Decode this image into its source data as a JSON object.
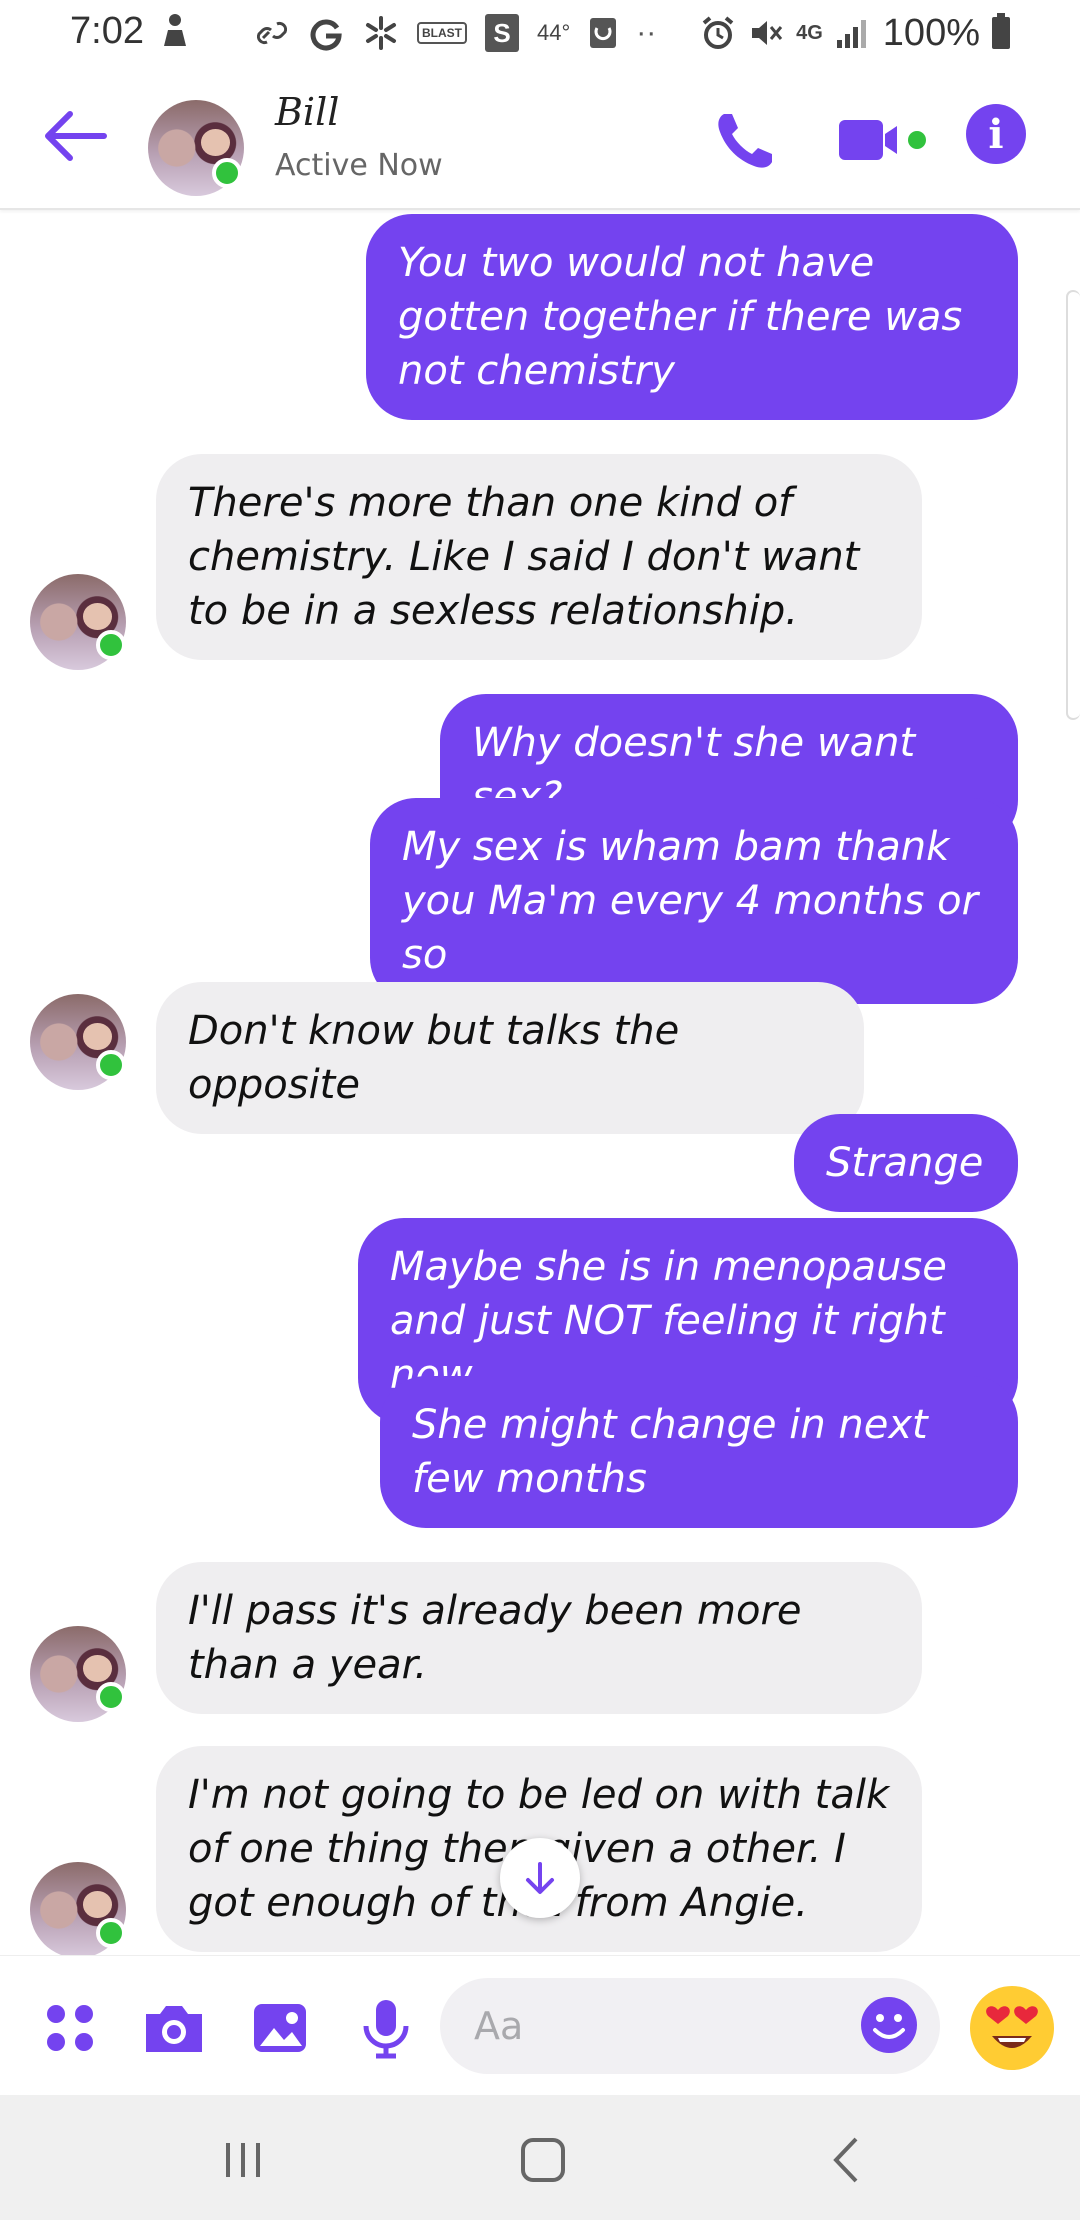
{
  "status_bar": {
    "time": "7:02",
    "temperature": "44°",
    "network": "4G",
    "battery": "100%",
    "notif_s": "S",
    "notif_blast": "BLAST"
  },
  "header": {
    "contact_name": "Bill",
    "contact_status": "Active Now",
    "info_glyph": "i"
  },
  "messages": [
    {
      "direction": "out",
      "text": "You two would not have gotten together if there was not chemistry"
    },
    {
      "direction": "in",
      "text": "There's more than one kind of chemistry. Like I said I don't want to be in a sexless relationship."
    },
    {
      "direction": "out",
      "text": "Why doesn't she want sex?"
    },
    {
      "direction": "out",
      "text": "My sex is wham bam thank you Ma'm every 4 months or so"
    },
    {
      "direction": "in",
      "text": "Don't know but talks the opposite"
    },
    {
      "direction": "out",
      "text": "Strange"
    },
    {
      "direction": "out",
      "text": "Maybe she is in menopause and just NOT feeling it right now"
    },
    {
      "direction": "out",
      "text": "She might change in next few months"
    },
    {
      "direction": "in",
      "text": "I'll pass it's already been more than a year."
    },
    {
      "direction": "in",
      "text": "I'm not going to be led on with talk of one thing then given a other. I got enough of that from Angie."
    }
  ],
  "composer": {
    "placeholder": "Aa"
  },
  "colors": {
    "accent": "#7443ef",
    "incoming_bubble": "#efeef0",
    "online": "#31c23d"
  },
  "icons": [
    "back-arrow-icon",
    "phone-icon",
    "video-camera-icon",
    "info-icon",
    "apps-icon",
    "camera-icon",
    "gallery-icon",
    "microphone-icon",
    "emoji-icon",
    "heart-eyes-emoji-icon",
    "scroll-down-arrow-icon",
    "recent-apps-icon",
    "home-icon",
    "back-icon"
  ]
}
